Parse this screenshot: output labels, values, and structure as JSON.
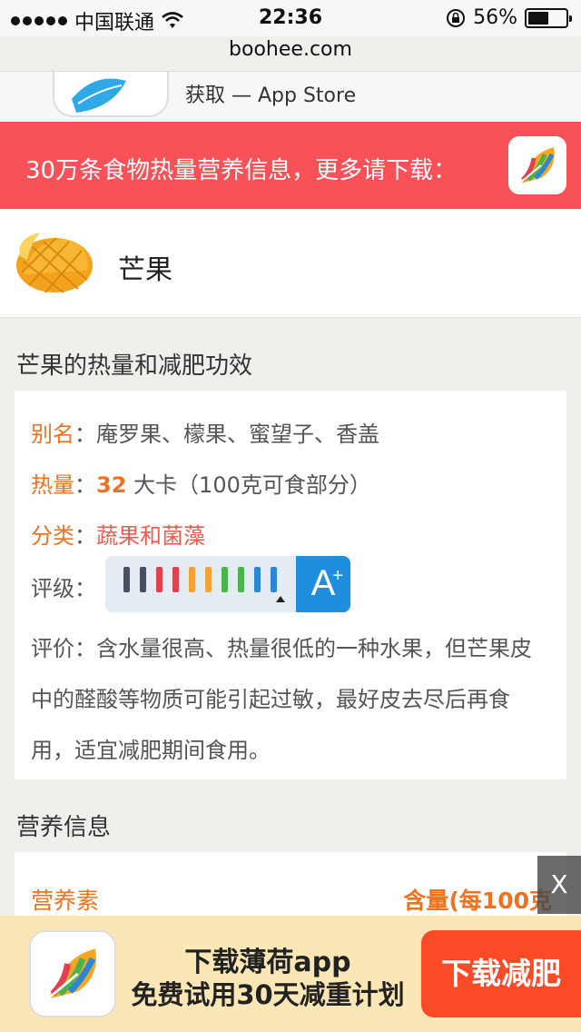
{
  "status": {
    "carrier": "中国联通",
    "time": "22:36",
    "battery": "56%",
    "battery_level": 0.56
  },
  "browser": {
    "url": "boohee.com"
  },
  "smart_banner": {
    "store_text": "获取 — App Store"
  },
  "banner": {
    "text": "30万条食物热量营养信息，更多请下载："
  },
  "food": {
    "name": "芒果"
  },
  "section1": {
    "title": "芒果的热量和减肥功效",
    "alias_label": "别名",
    "alias_value": "庵罗果、檬果、蜜望子、香盖",
    "calorie_label": "热量",
    "calorie_value": "32",
    "calorie_unit": "大卡（100克可食部分）",
    "category_label": "分类",
    "category_value": "蔬果和菌藻",
    "grade_label": "评级",
    "grade_letter": "A",
    "grade_plus": "+",
    "review_label": "评价",
    "review_text": "含水量很高、热量很低的一种水果，但芒果皮中的醛酸等物质可能引起过敏，最好皮去尽后再食用，适宜减肥期间食用。"
  },
  "section2": {
    "title": "营养信息",
    "col1": "营养素",
    "col2": "含量(每100克"
  },
  "close": {
    "label": "X"
  },
  "promo": {
    "line1": "下载薄荷app",
    "line2": "免费试用30天减重计划",
    "button": "下载减肥"
  },
  "colors": {
    "red_banner": "#f85157",
    "accent": "#f0711f",
    "grade_blue": "#1f8ede",
    "promo_bg": "#fbe7b6",
    "promo_btn": "#fb4a26"
  },
  "grade_bars": [
    "#4a4f60",
    "#4a4f60",
    "#e2404f",
    "#e2404f",
    "#f2a236",
    "#f2a236",
    "#4ab44a",
    "#4ab44a",
    "#2b86d6",
    "#2b86d6"
  ]
}
